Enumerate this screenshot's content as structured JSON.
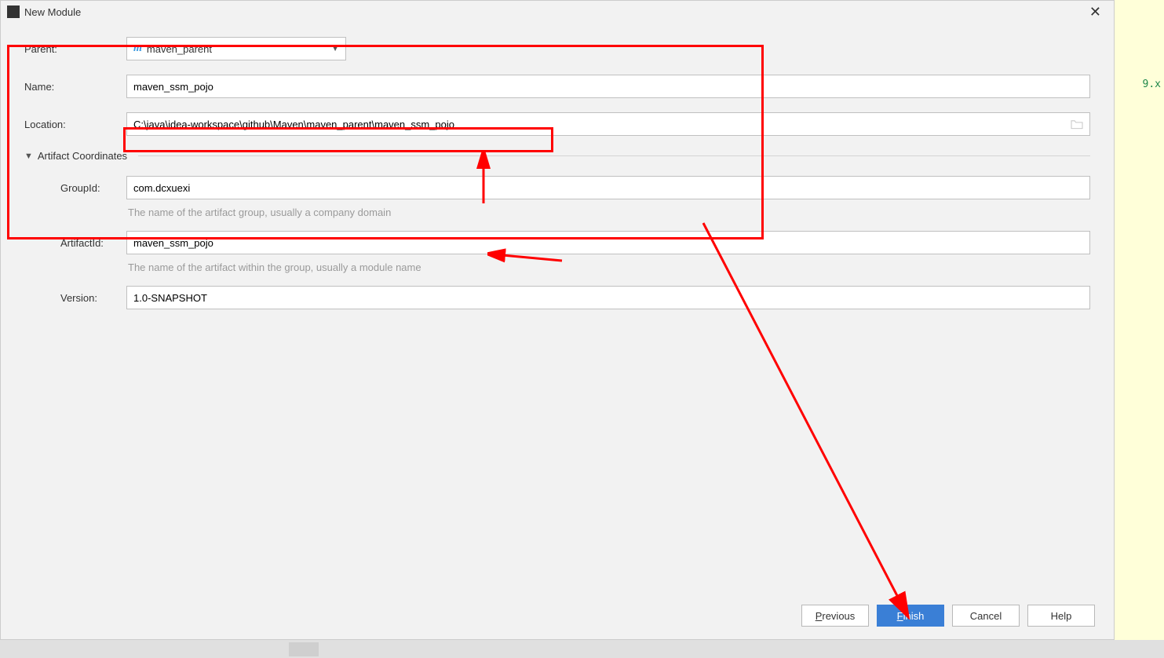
{
  "title": "New Module",
  "labels": {
    "parent": "Parent:",
    "name": "Name:",
    "location": "Location:",
    "groupId": "GroupId:",
    "artifactId": "ArtifactId:",
    "version": "Version:"
  },
  "values": {
    "parent": "maven_parent",
    "name": "maven_ssm_pojo",
    "location": "C:\\java\\idea-workspace\\github\\Maven\\maven_parent\\maven_ssm_pojo",
    "groupId": "com.dcxuexi",
    "artifactId": "maven_ssm_pojo",
    "version": "1.0-SNAPSHOT"
  },
  "section": {
    "artifactCoordinates": "Artifact Coordinates"
  },
  "hints": {
    "groupId": "The name of the artifact group, usually a company domain",
    "artifactId": "The name of the artifact within the group, usually a module name"
  },
  "buttons": {
    "previous": "Previous",
    "finish": "Finish",
    "cancel": "Cancel",
    "help": "Help"
  },
  "bgText": "9.x"
}
